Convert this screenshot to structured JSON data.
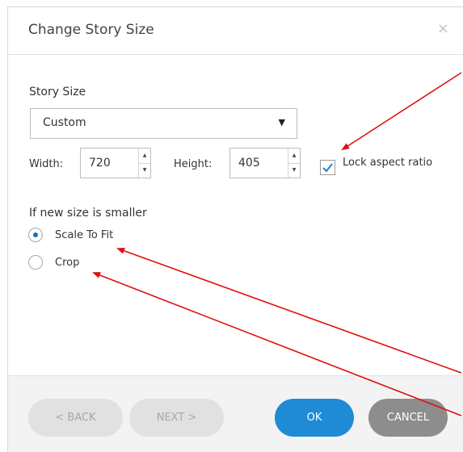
{
  "dialog": {
    "title": "Change Story Size",
    "close_glyph": "×"
  },
  "story_size": {
    "label": "Story Size",
    "selected": "Custom"
  },
  "width": {
    "label": "Width:",
    "value": "720"
  },
  "height": {
    "label": "Height:",
    "value": "405"
  },
  "lock_aspect": {
    "label": "Lock aspect ratio",
    "checked": true
  },
  "smaller": {
    "label": "If new size is smaller",
    "options": [
      {
        "label": "Scale To Fit",
        "selected": true
      },
      {
        "label": "Crop",
        "selected": false
      }
    ]
  },
  "footer": {
    "back": "< BACK",
    "next": "NEXT >",
    "ok": "OK",
    "cancel": "CANCEL"
  },
  "colors": {
    "accent": "#1f8bd6",
    "annotation_arrow": "#e01010"
  }
}
